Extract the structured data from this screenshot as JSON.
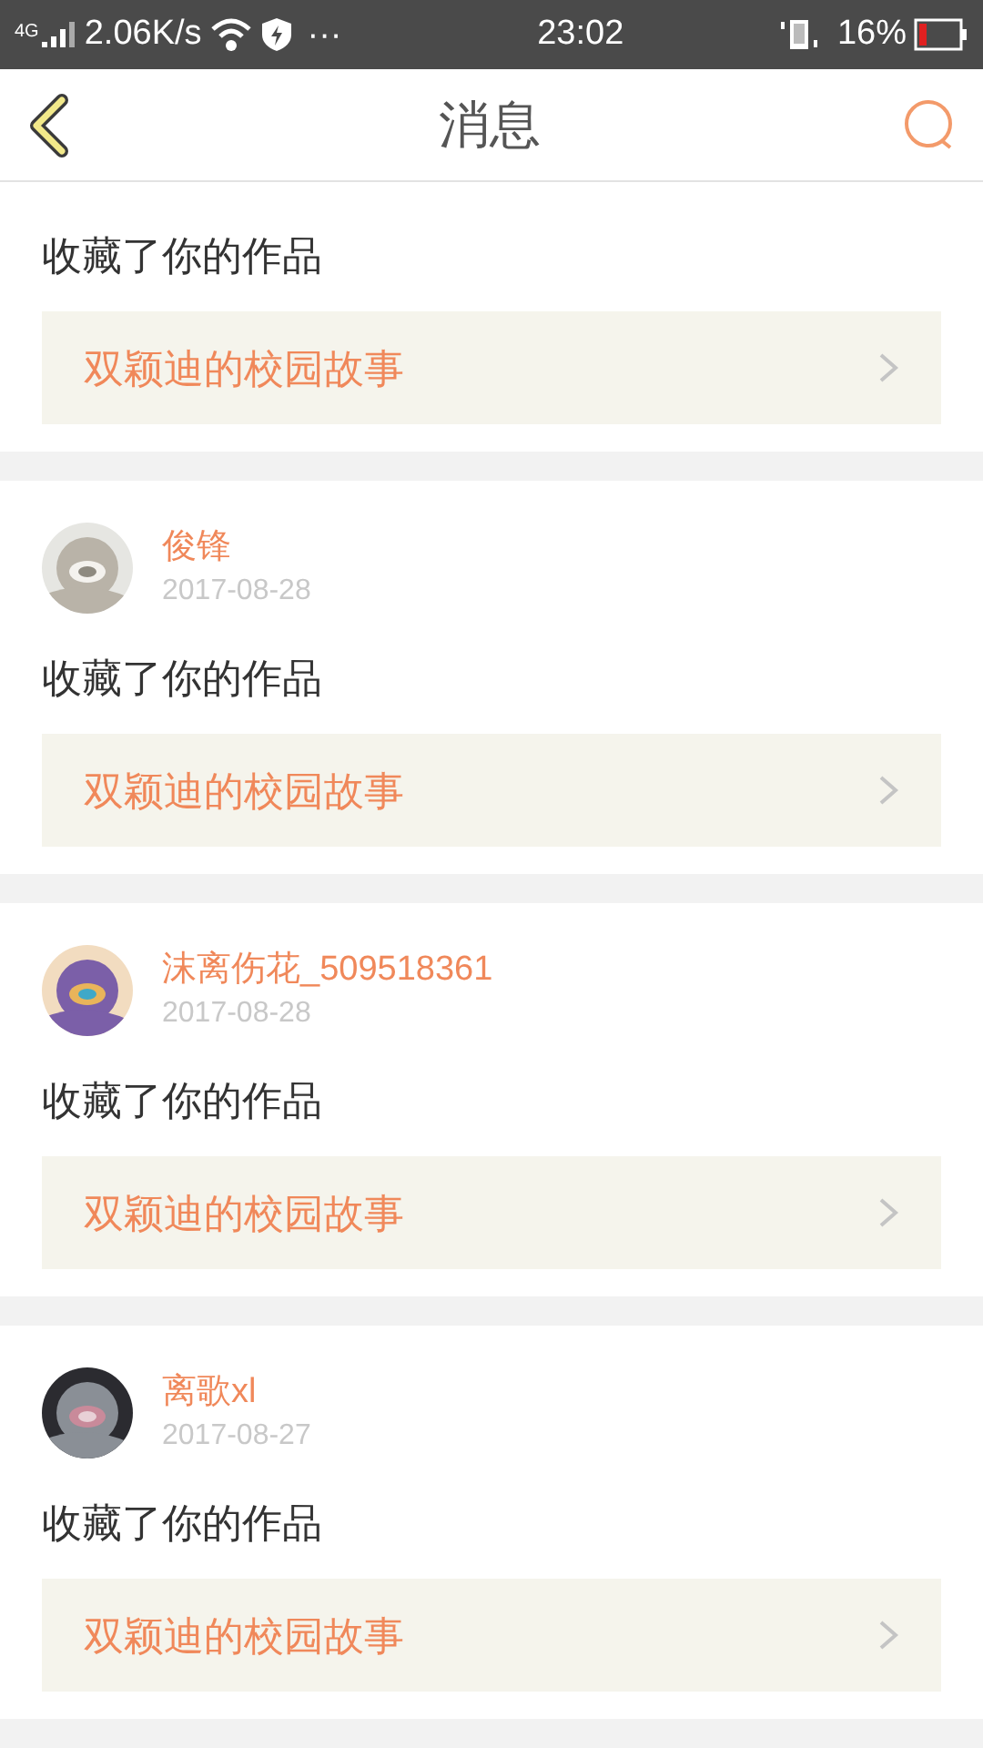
{
  "status_bar": {
    "network": "4G",
    "speed": "2.06K/s",
    "more": "···",
    "time": "23:02",
    "battery": "16%"
  },
  "header": {
    "title": "消息"
  },
  "messages": [
    {
      "action": "收藏了你的作品",
      "work": "双颖迪的校园故事"
    },
    {
      "user": "俊锋",
      "date": "2017-08-28",
      "action": "收藏了你的作品",
      "work": "双颖迪的校园故事"
    },
    {
      "user": "沫离伤花_509518361",
      "date": "2017-08-28",
      "action": "收藏了你的作品",
      "work": "双颖迪的校园故事"
    },
    {
      "user": "离歌xl",
      "date": "2017-08-27",
      "action": "收藏了你的作品",
      "work": "双颖迪的校园故事"
    }
  ]
}
